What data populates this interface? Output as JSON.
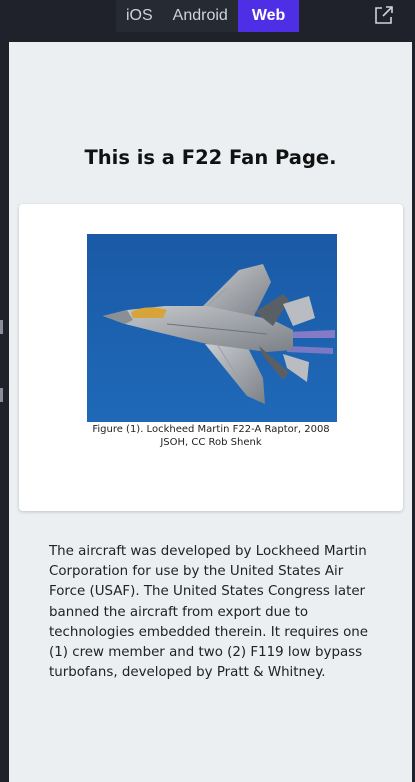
{
  "toolbar": {
    "tabs": [
      {
        "label": "iOS"
      },
      {
        "label": "Android"
      },
      {
        "label": "Web"
      }
    ],
    "active_tab": "Web",
    "accent_color": "#4f2fe6",
    "open_external_icon": "external-link-icon"
  },
  "page": {
    "title": "This is a F22 Fan Page.",
    "figure": {
      "caption_line1": "Figure (1). Lockheed Martin F22-A Raptor, 2008",
      "caption_line2": "JSOH, CC Rob Shenk"
    },
    "body": "The aircraft was developed by Lockheed Martin Corporation for use by the United States Air Force (USAF). The United States Congress later banned the aircraft from export due to technologies embedded therein. It requires one (1) crew member and two (2) F119 low bypass turbofans, developed by Pratt & Whitney."
  }
}
